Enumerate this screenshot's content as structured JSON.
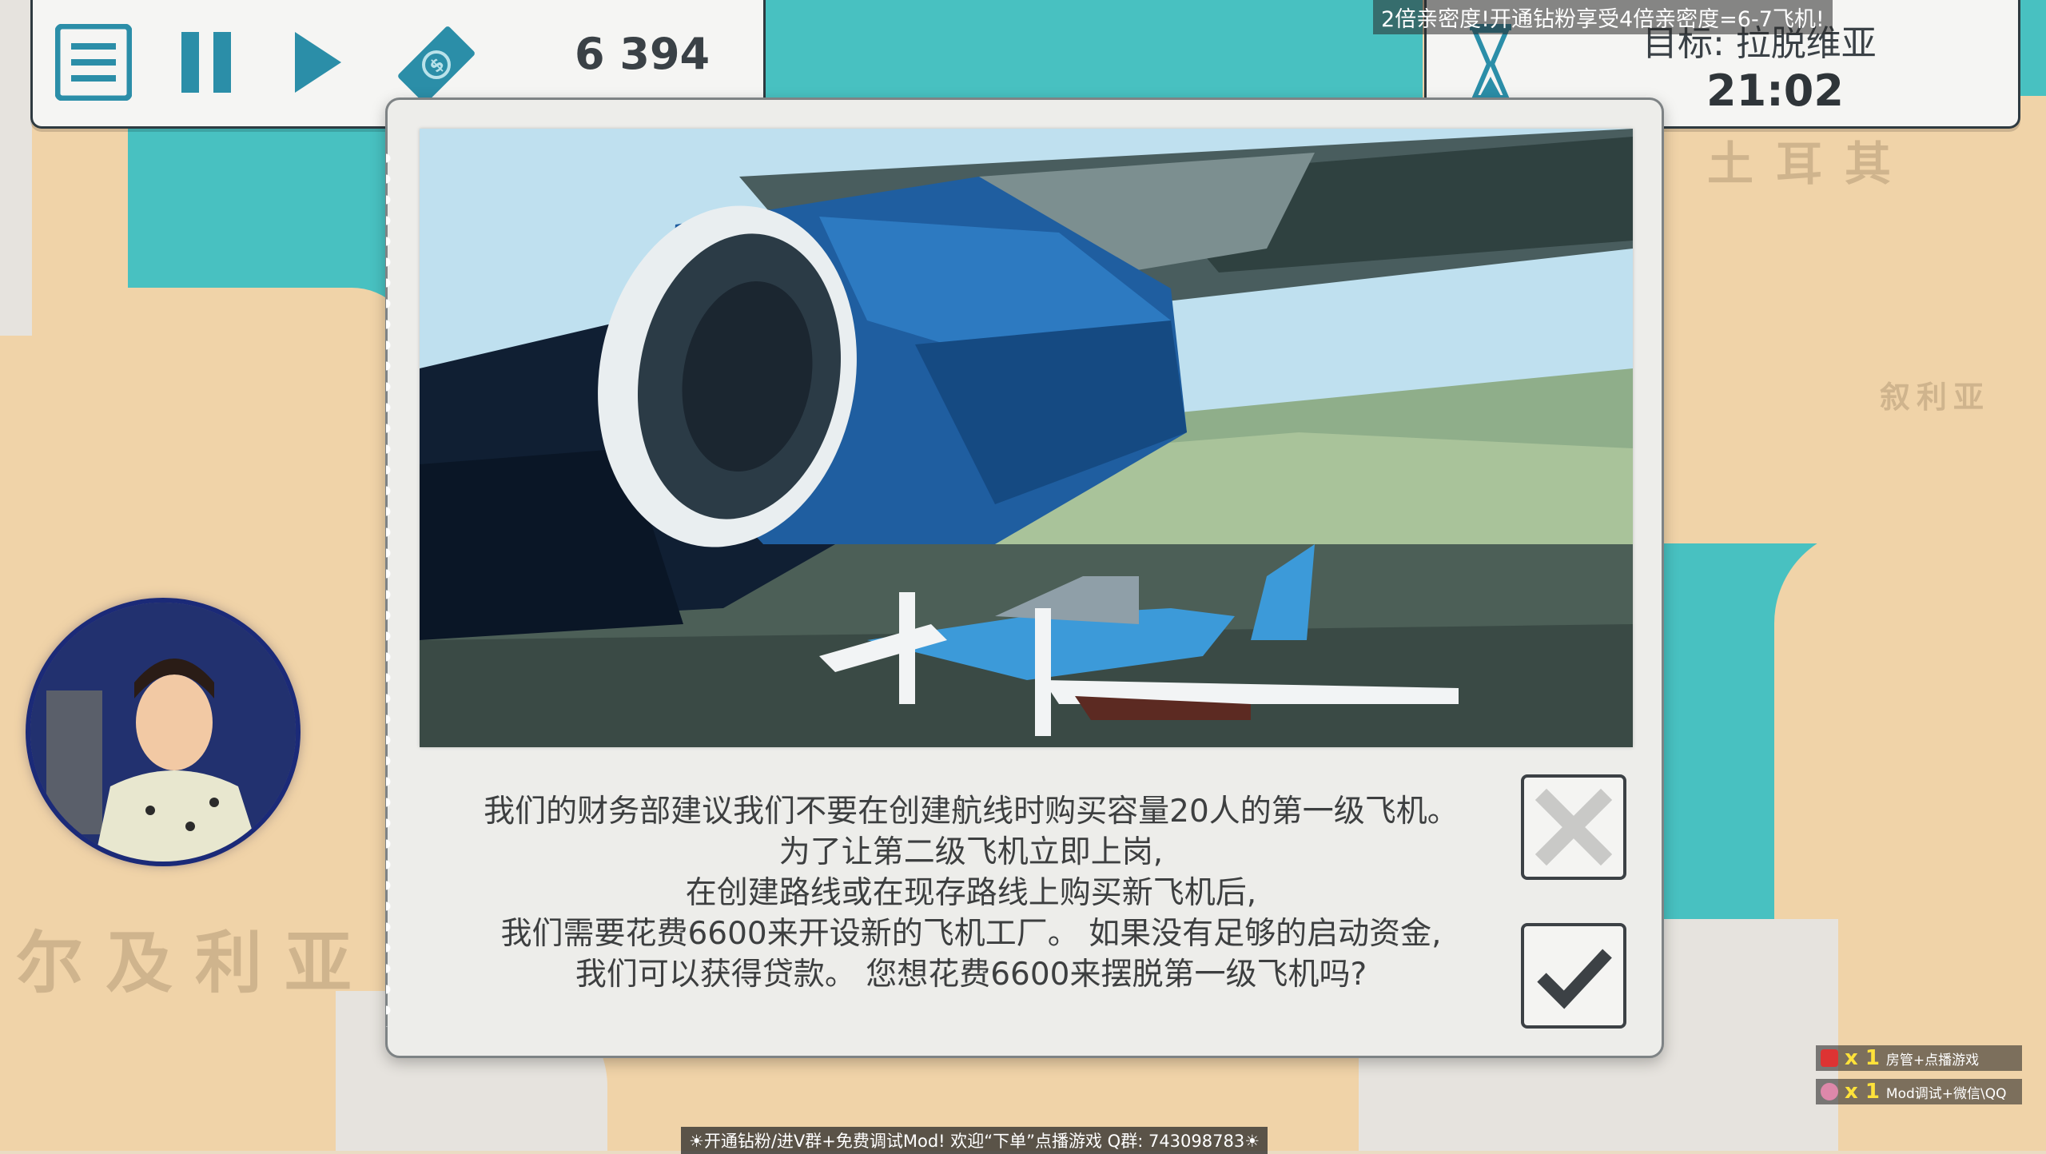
{
  "hud": {
    "money": "6 394",
    "goal": "目标: 拉脱维亚",
    "timer": "21:02",
    "icons": [
      "menu-icon",
      "pause-icon",
      "play-icon",
      "money-icon",
      "hourglass-icon"
    ]
  },
  "map": {
    "labels": [
      "尔及利亚",
      "土耳其",
      "叙利亚"
    ]
  },
  "dialog": {
    "lines": [
      "我们的财务部建议我们不要在创建航线时购买容量20人的第一级飞机。",
      "为了让第二级飞机立即上岗,",
      "在创建路线或在现存路线上购买新飞机后,",
      "我们需要花费6600来开设新的飞机工厂。 如果没有足够的启动资金,",
      "我们可以获得贷款。 您想花费6600来摆脱第一级飞机吗?"
    ],
    "cancel_icon": "close-icon",
    "confirm_icon": "checkmark-icon"
  },
  "overlay": {
    "top_banner": "2倍亲密度!开通钻粉享受4倍亲密度=6-7飞机!",
    "bottom_banner": "☀开通钻粉/进V群+免费调试Mod! 欢迎“下单”点播游戏 Q群: 743098783☀",
    "gifts": [
      {
        "count": "x 1",
        "label": "房管+点播游戏"
      },
      {
        "count": "x 1",
        "label": "Mod调试+微信\\QQ"
      }
    ]
  },
  "colors": {
    "sea": "#48c1c1",
    "land": "#f0d3a8",
    "hud_icon": "#2b8ea8",
    "dialog_bg": "#ededea"
  }
}
